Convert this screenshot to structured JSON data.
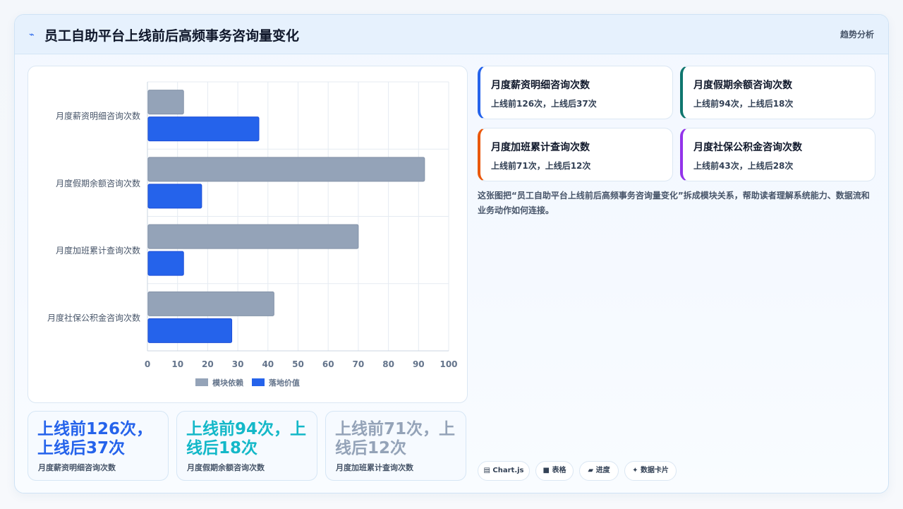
{
  "header": {
    "icon": "trend-icon",
    "title": "员工自助平台上线前后高频事务咨询量变化",
    "tag": "趋势分析"
  },
  "chart_data": {
    "type": "bar",
    "orientation": "horizontal",
    "categories": [
      "月度薪资明细咨询次数",
      "月度假期余额咨询次数",
      "月度加班累计查询次数",
      "月度社保公积金咨询次数"
    ],
    "series": [
      {
        "name": "模块依赖",
        "color": "#94a3b8",
        "values": [
          12,
          92,
          70,
          42
        ]
      },
      {
        "name": "落地价值",
        "color": "#2563eb",
        "values": [
          37,
          18,
          12,
          28
        ]
      }
    ],
    "xlim": [
      0,
      100
    ],
    "xticks": [
      0,
      10,
      20,
      30,
      40,
      50,
      60,
      70,
      80,
      90,
      100
    ],
    "grid": true,
    "legend_position": "bottom"
  },
  "stats": [
    {
      "value": "上线前126次，上线后37次",
      "label": "月度薪资明细咨询次数",
      "color": "#2563eb"
    },
    {
      "value": "上线前94次，上线后18次",
      "label": "月度假期余额咨询次数",
      "color": "#14b8c8"
    },
    {
      "value": "上线前71次，上线后12次",
      "label": "月度加班累计查询次数",
      "color": "#94a3b8"
    }
  ],
  "modules": [
    {
      "title": "月度薪资明细咨询次数",
      "detail": "上线前126次，上线后37次",
      "accent": "#2563eb"
    },
    {
      "title": "月度假期余额咨询次数",
      "detail": "上线前94次，上线后18次",
      "accent": "#0f766e"
    },
    {
      "title": "月度加班累计查询次数",
      "detail": "上线前71次，上线后12次",
      "accent": "#ea580c"
    },
    {
      "title": "月度社保公积金咨询次数",
      "detail": "上线前43次，上线后28次",
      "accent": "#9333ea"
    }
  ],
  "description": "这张图把“员工自助平台上线前后高频事务咨询量变化”拆成模块关系，帮助读者理解系统能力、数据流和业务动作如何连接。",
  "chips": [
    {
      "icon": "▤",
      "label": "Chart.js"
    },
    {
      "icon": "■",
      "label": "表格"
    },
    {
      "icon": "▰",
      "label": "进度"
    },
    {
      "icon": "✦",
      "label": "数据卡片"
    }
  ]
}
